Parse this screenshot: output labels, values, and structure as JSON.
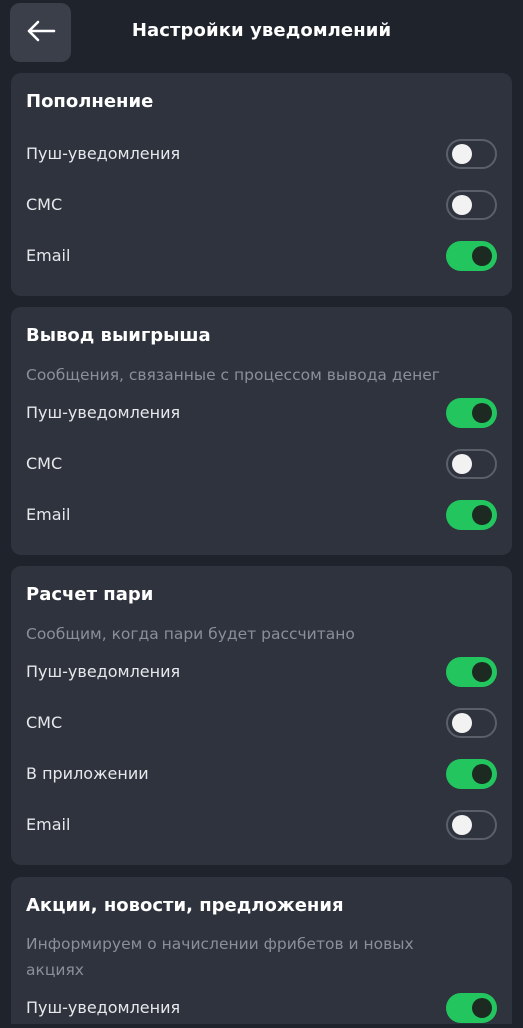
{
  "header": {
    "title": "Настройки уведомлений",
    "back_icon": "arrow-left-icon"
  },
  "colors": {
    "background": "#1f232b",
    "card": "#2f333d",
    "toggle_on": "#22c55e",
    "toggle_off_border": "#5a5f6a"
  },
  "sections": [
    {
      "title": "Пополнение",
      "rows": [
        {
          "label": "Пуш-уведомления",
          "enabled": false
        },
        {
          "label": "СМС",
          "enabled": false
        },
        {
          "label": "Email",
          "enabled": true
        }
      ]
    },
    {
      "title": "Вывод выигрыша",
      "description": "Сообщения, связанные с процессом вывода денег",
      "rows": [
        {
          "label": "Пуш-уведомления",
          "enabled": true
        },
        {
          "label": "СМС",
          "enabled": false
        },
        {
          "label": "Email",
          "enabled": true
        }
      ]
    },
    {
      "title": "Расчет пари",
      "description": "Сообщим, когда пари будет рассчитано",
      "rows": [
        {
          "label": "Пуш-уведомления",
          "enabled": true
        },
        {
          "label": "СМС",
          "enabled": false
        },
        {
          "label": "В приложении",
          "enabled": true
        },
        {
          "label": "Email",
          "enabled": false
        }
      ]
    },
    {
      "title": "Акции, новости, предложения",
      "description": "Информируем о начислении фрибетов и новых акциях",
      "rows": [
        {
          "label": "Пуш-уведомления",
          "enabled": true
        }
      ]
    }
  ]
}
